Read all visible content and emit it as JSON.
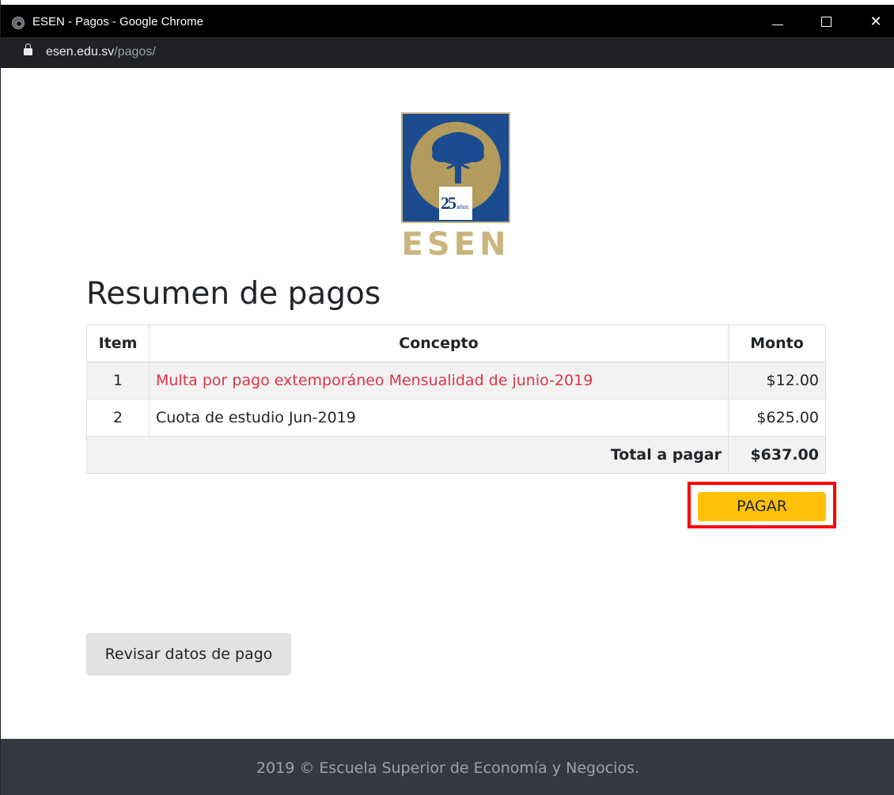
{
  "window": {
    "title": "ESEN - Pagos - Google Chrome",
    "minimize_glyph": "",
    "maximize_glyph": "",
    "close_glyph": "✕"
  },
  "address_bar": {
    "host": "esen.edu.sv",
    "path": "/pagos/"
  },
  "logo": {
    "anniversary_number": "25",
    "anniversary_word": "años",
    "wordmark": "ESEN"
  },
  "page": {
    "heading": "Resumen de pagos"
  },
  "table": {
    "headers": [
      "Item",
      "Concepto",
      "Monto"
    ],
    "rows": [
      {
        "item": "1",
        "concepto": "Multa por pago extemporáneo Mensualidad de junio-2019",
        "monto": "$12.00",
        "status": "alert"
      },
      {
        "item": "2",
        "concepto": "Cuota de estudio Jun-2019",
        "monto": "$625.00",
        "status": "normal"
      }
    ],
    "total_label": "Total a pagar",
    "total_value": "$637.00"
  },
  "actions": {
    "pay_label": "PAGAR",
    "review_label": "Revisar datos de pago"
  },
  "footer": {
    "text": "2019 © Escuela Superior de Economía y Negocios."
  },
  "colors": {
    "alert_text": "#dc3545",
    "pay_button": "#ffc107",
    "highlight": "#ff0000",
    "logo_blue": "#1b4c8f",
    "logo_gold": "#c9b57d",
    "footer_bg": "#343a40"
  }
}
